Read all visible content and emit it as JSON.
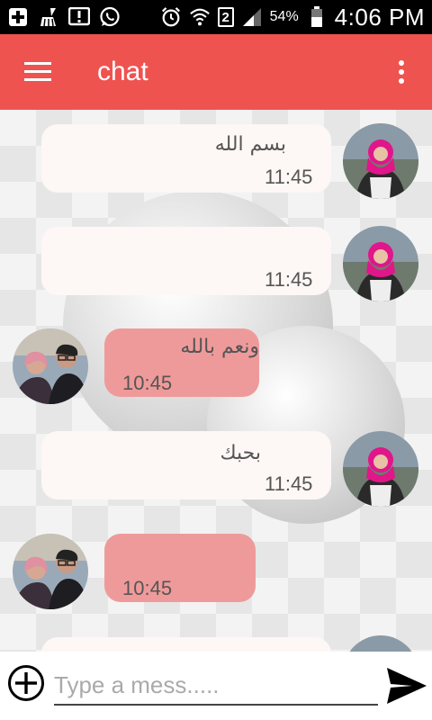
{
  "status_bar": {
    "battery_percent": "54%",
    "time": "4:06 PM",
    "sim_label": "2",
    "icons": [
      "add-box-icon",
      "cleaner-icon",
      "alert-box-icon",
      "whatsapp-icon",
      "alarm-icon",
      "wifi-icon",
      "sim-icon",
      "signal-icon",
      "battery-icon"
    ]
  },
  "app_bar": {
    "title": "chat",
    "menu_icon": "hamburger-menu-icon",
    "overflow_icon": "overflow-menu-icon",
    "color": "#ef5350"
  },
  "messages": [
    {
      "side": "in",
      "text": "بسم الله",
      "time": "11:45",
      "avatar": "woman-avatar"
    },
    {
      "side": "in",
      "text": "",
      "time": "11:45",
      "avatar": "woman-avatar"
    },
    {
      "side": "out",
      "text": "ونعم بالله",
      "time": "10:45",
      "avatar": "couple-avatar"
    },
    {
      "side": "in",
      "text": "بحبك",
      "time": "11:45",
      "avatar": "woman-avatar"
    },
    {
      "side": "out",
      "text": "",
      "time": "10:45",
      "avatar": "couple-avatar"
    },
    {
      "side": "in",
      "text": "",
      "time": "",
      "avatar": "woman-avatar"
    }
  ],
  "input_bar": {
    "placeholder": "Type a mess.....",
    "value": "",
    "add_icon": "add-circle-icon",
    "send_icon": "send-icon"
  },
  "colors": {
    "incoming_bubble": "#fdf7f5",
    "outgoing_bubble": "#ef9a9a"
  }
}
